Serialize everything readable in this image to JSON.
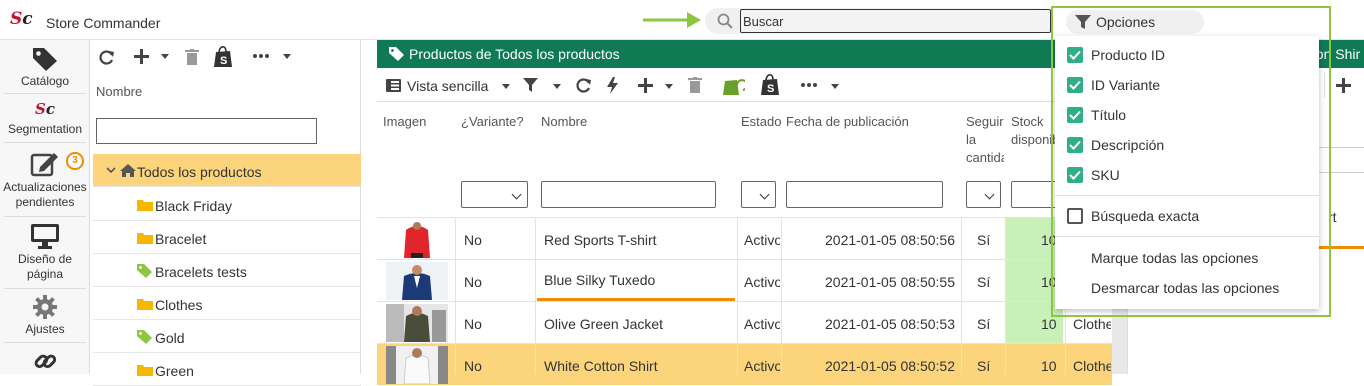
{
  "app": {
    "logo": "Sc",
    "title": "Store Commander"
  },
  "search": {
    "placeholder": "Buscar"
  },
  "options_button": {
    "label": "Opciones"
  },
  "left_nav": [
    {
      "label": "Catálogo",
      "icon": "tag-icon"
    },
    {
      "label": "Segmentation",
      "icon": "sc-logo-icon"
    },
    {
      "label": "Actualizaciones pendientes",
      "icon": "edit-icon",
      "badge": "3"
    },
    {
      "label": "Diseño de página",
      "icon": "monitor-icon"
    },
    {
      "label": "Ajustes",
      "icon": "gear-icon"
    },
    {
      "label": "",
      "icon": "link-icon"
    }
  ],
  "category_panel": {
    "column_label": "Nombre",
    "filter_value": "",
    "tree": [
      {
        "label": "Todos los productos",
        "icon": "home-icon",
        "expanded": true,
        "selected": true
      },
      {
        "label": "Black Friday",
        "icon": "folder-icon"
      },
      {
        "label": "Bracelet",
        "icon": "folder-icon"
      },
      {
        "label": "Bracelets tests",
        "icon": "tag-icon"
      },
      {
        "label": "Clothes",
        "icon": "folder-icon"
      },
      {
        "label": "Gold",
        "icon": "tag-icon"
      },
      {
        "label": "Green",
        "icon": "folder-icon"
      }
    ]
  },
  "products_panel": {
    "title": "Productos de Todos los productos",
    "view_label": "Vista sencilla",
    "columns": [
      "Imagen",
      "¿Variante?",
      "Nombre",
      "Estado",
      "Fecha de publicación",
      "Seguir la cantidad",
      "Stock disponible"
    ],
    "rows": [
      {
        "variant": "No",
        "name": "Red Sports T-shirt",
        "status": "Activo",
        "date": "2021-01-05 08:50:56",
        "track": "Sí",
        "stock": "10",
        "extra": "",
        "selected": false
      },
      {
        "variant": "No",
        "name": "Blue Silky Tuxedo",
        "status": "Activo",
        "date": "2021-01-05 08:50:55",
        "track": "Sí",
        "stock": "10",
        "extra": "",
        "selected": false
      },
      {
        "variant": "No",
        "name": "Olive Green Jacket",
        "status": "Activo",
        "date": "2021-01-05 08:50:53",
        "track": "Sí",
        "stock": "10",
        "extra": "Clothe",
        "selected": false
      },
      {
        "variant": "No",
        "name": "White Cotton Shirt",
        "status": "Activo",
        "date": "2021-01-05 08:50:52",
        "track": "Sí",
        "stock": "10",
        "extra": "Clothe",
        "selected": true
      }
    ]
  },
  "right_panel": {
    "title_fragment": "tton Shir",
    "fragment": "rt"
  },
  "options_dropdown": {
    "items": [
      {
        "label": "Producto ID",
        "checked": true
      },
      {
        "label": "ID Variante",
        "checked": true
      },
      {
        "label": "Título",
        "checked": true
      },
      {
        "label": "Descripción",
        "checked": true
      },
      {
        "label": "SKU",
        "checked": true
      }
    ],
    "exact_search": {
      "label": "Búsqueda exacta",
      "checked": false
    },
    "check_all": "Marque todas las opciones",
    "uncheck_all": "Desmarcar todas las opciones"
  },
  "colors": {
    "accent_green": "#0f7a54",
    "selection": "#fcd47c",
    "checkbox": "#2fae8a",
    "highlight_frame": "#8dc63f",
    "stock_cell": "#c9f0b8",
    "badge": "#f08c00"
  }
}
